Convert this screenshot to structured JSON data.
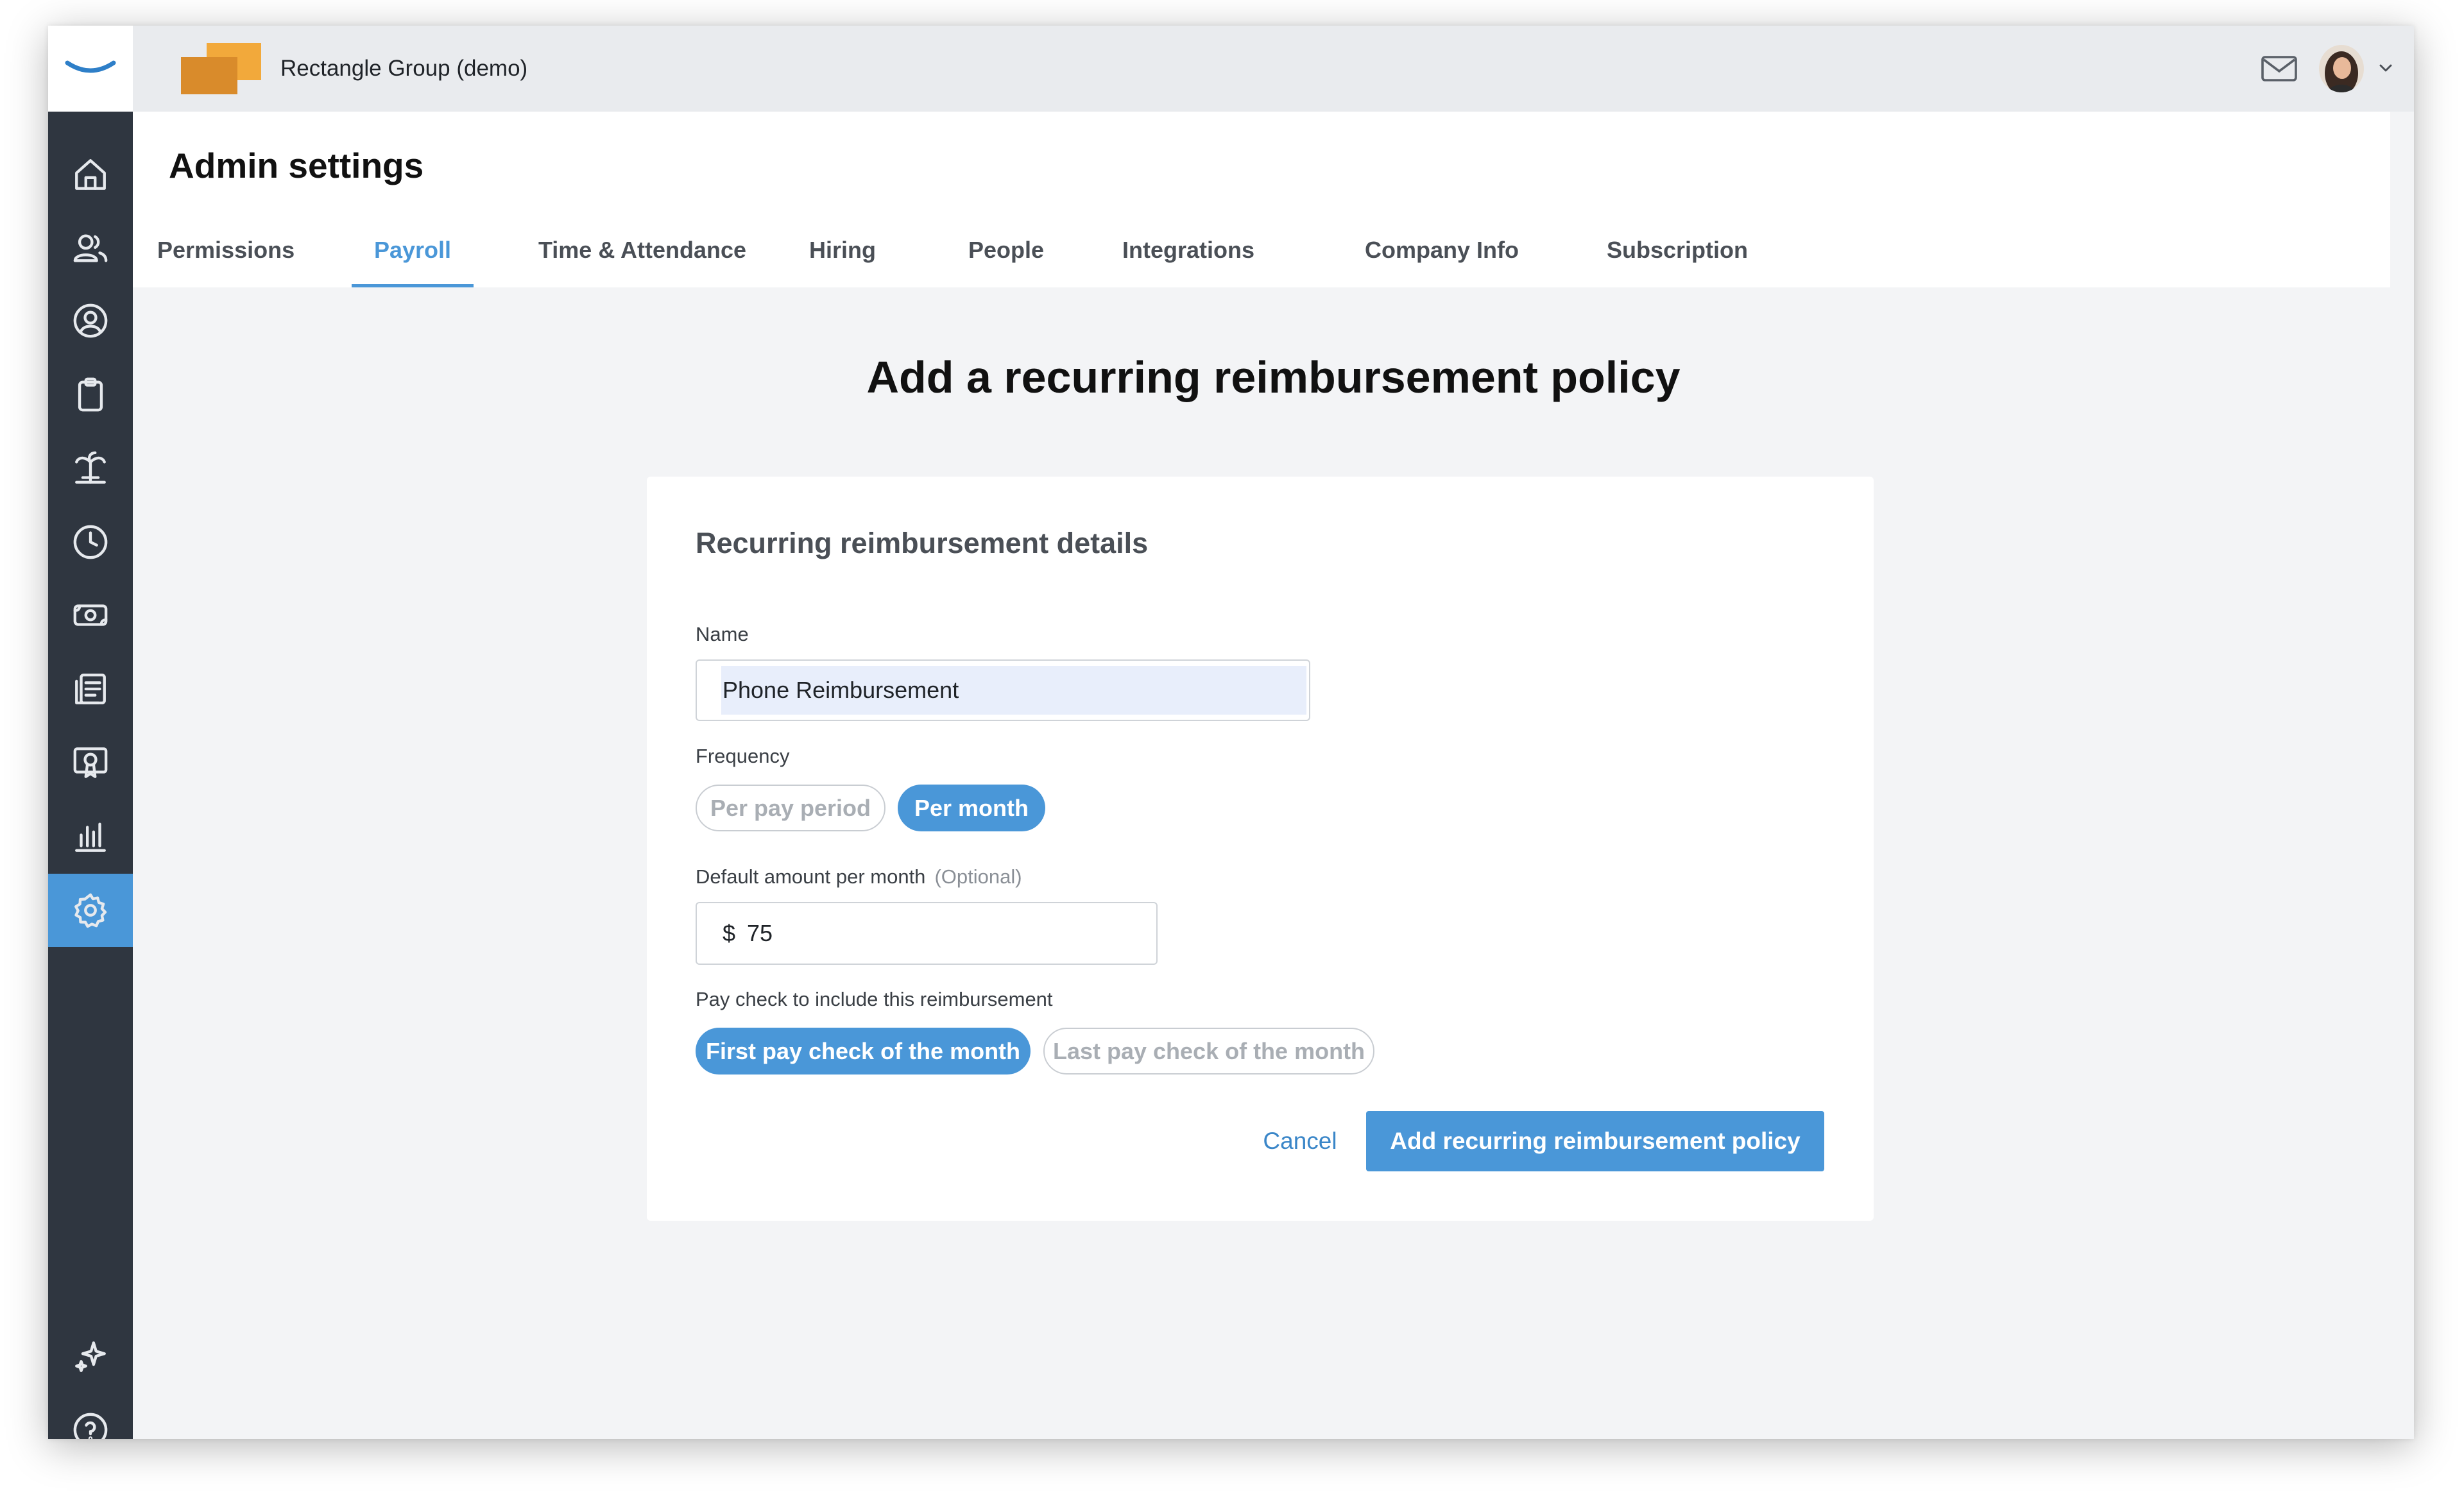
{
  "app": {
    "company_name": "Rectangle Group (demo)"
  },
  "sidebar": {
    "icons": [
      "home-icon",
      "people-icon",
      "profile-icon",
      "clipboard-icon",
      "vacation-icon",
      "clock-icon",
      "money-icon",
      "documents-icon",
      "certificate-icon",
      "reports-icon",
      "settings-icon",
      "sparkle-icon",
      "help-icon"
    ],
    "active": "settings-icon"
  },
  "topbar": {
    "icons": [
      "mail-icon",
      "avatar",
      "chevron-down-icon"
    ]
  },
  "header": {
    "title": "Admin settings",
    "tabs": [
      {
        "label": "Permissions"
      },
      {
        "label": "Payroll",
        "active": true
      },
      {
        "label": "Time & Attendance"
      },
      {
        "label": "Hiring"
      },
      {
        "label": "People"
      },
      {
        "label": "Integrations"
      },
      {
        "label": "Company Info"
      },
      {
        "label": "Subscription"
      }
    ]
  },
  "main": {
    "title": "Add a recurring reimbursement policy",
    "card": {
      "title": "Recurring reimbursement details",
      "name": {
        "label": "Name",
        "value": "Phone Reimbursement"
      },
      "frequency": {
        "label": "Frequency",
        "options": [
          "Per pay period",
          "Per month"
        ],
        "selected": "Per month"
      },
      "amount": {
        "label": "Default amount per month",
        "optional": "(Optional)",
        "currency": "$",
        "value": "75"
      },
      "paycheck": {
        "label": "Pay check to include this reimbursement",
        "options": [
          "First pay check of the month",
          "Last pay check of the month"
        ],
        "selected": "First pay check of the month"
      },
      "actions": {
        "cancel": "Cancel",
        "submit": "Add recurring reimbursement policy"
      }
    }
  },
  "colors": {
    "accent": "#4a97d8",
    "sidebar": "#2f3640",
    "brand_orange": "#f2a93b"
  }
}
